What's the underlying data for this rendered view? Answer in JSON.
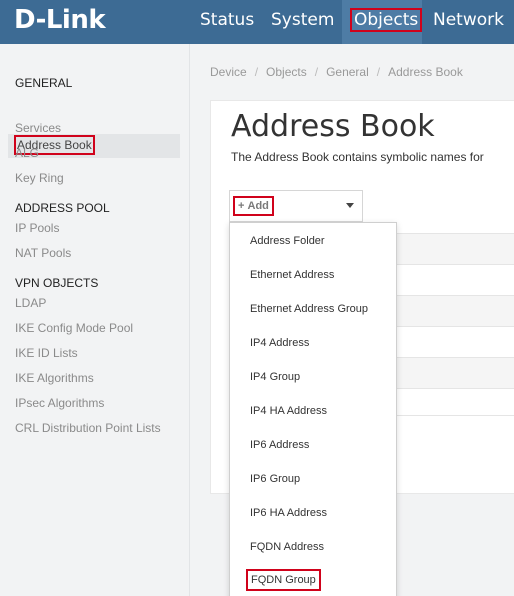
{
  "header": {
    "logo": "D-Link",
    "nav": {
      "status": "Status",
      "system": "System",
      "objects": "Objects",
      "network": "Network"
    }
  },
  "sidebar": {
    "general_heading": "GENERAL",
    "general_items": [
      "Address Book",
      "Services",
      "ALG",
      "Key Ring"
    ],
    "address_pool_heading": "ADDRESS POOL",
    "address_pool_items": [
      "IP Pools",
      "NAT Pools"
    ],
    "vpn_heading": "VPN OBJECTS",
    "vpn_items": [
      "LDAP",
      "IKE Config Mode Pool",
      "IKE ID Lists",
      "IKE Algorithms",
      "IPsec Algorithms",
      "CRL Distribution Point Lists"
    ]
  },
  "breadcrumb": {
    "items": [
      "Device",
      "Objects",
      "General",
      "Address Book"
    ],
    "separator": "/"
  },
  "main": {
    "title": "Address Book",
    "description": "The Address Book contains symbolic names for",
    "add_button": "Add",
    "add_icon": "plus-icon"
  },
  "add_menu": {
    "items": [
      "Address Folder",
      "Ethernet Address",
      "Ethernet Address Group",
      "IP4 Address",
      "IP4 Group",
      "IP4 HA Address",
      "IP6 Address",
      "IP6 Group",
      "IP6 HA Address",
      "FQDN Address",
      "FQDN Group"
    ]
  },
  "colors": {
    "topbar": "#3d6b94",
    "topbar_active": "#4e7ca5",
    "highlight_box": "#d0021b"
  }
}
